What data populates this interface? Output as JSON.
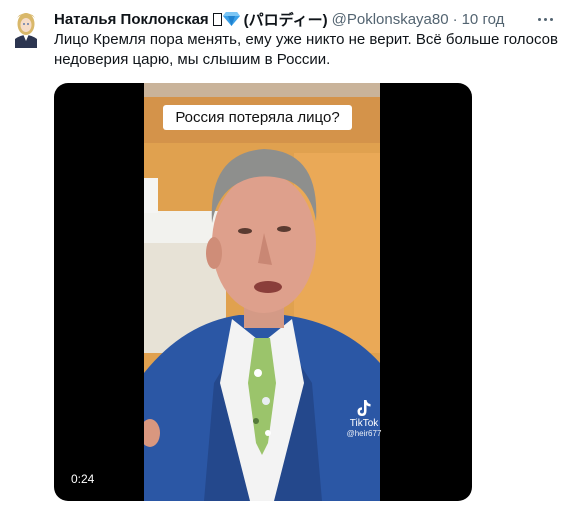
{
  "tweet": {
    "author_name": "Наталья Поклонская",
    "parody_label": "(パロディー)",
    "handle": "@Poklonskaya80",
    "separator": "·",
    "time": "10 год",
    "text": "Лицо Кремля пора менять, ему уже никто не верит. Всё больше голосов недоверия царю, мы слышим в России."
  },
  "media": {
    "caption": "Россия потеряла лицо?",
    "watermark_label": "TikTok",
    "watermark_user": "@heir677",
    "duration": "0:24"
  },
  "icons": {
    "more": "more-horizontal-icon",
    "diamond": "blue-diamond-icon",
    "tiktok": "tiktok-logo-icon"
  },
  "colors": {
    "secondary_text": "#536471",
    "primary_text": "#0f1419",
    "diamond": "#3aa0e8"
  }
}
